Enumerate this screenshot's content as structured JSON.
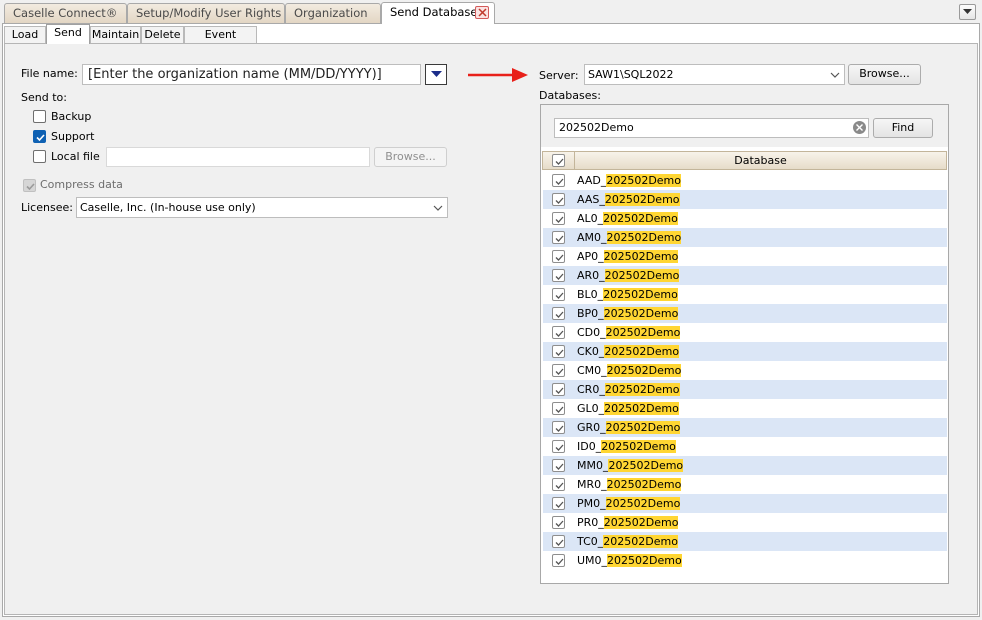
{
  "doc_tabs": [
    {
      "label": "Caselle Connect®",
      "active": false
    },
    {
      "label": "Setup/Modify User Rights",
      "active": false
    },
    {
      "label": "Organization",
      "active": false
    },
    {
      "label": "Send Databases",
      "active": true
    }
  ],
  "sub_tabs": [
    {
      "label": "Load",
      "active": false
    },
    {
      "label": "Send",
      "active": true
    },
    {
      "label": "Maintain",
      "active": false
    },
    {
      "label": "Delete",
      "active": false
    },
    {
      "label": "Event Viewer",
      "active": false
    }
  ],
  "form": {
    "file_name_label": "File name:",
    "file_name_value": "[Enter the organization name (MM/DD/YYYY)]",
    "send_to_label": "Send to:",
    "backup_label": "Backup",
    "backup_checked": false,
    "support_label": "Support",
    "support_checked": true,
    "local_file_label": "Local file",
    "local_file_checked": false,
    "local_file_value": "",
    "browse_local_label": "Browse...",
    "compress_label": "Compress data",
    "compress_checked": true,
    "licensee_label": "Licensee:",
    "licensee_value": "Caselle, Inc. (In-house use only)"
  },
  "server": {
    "label": "Server:",
    "value": "SAW1\\SQL2022",
    "browse_label": "Browse...",
    "annotation_arrow_color": "#e8201a"
  },
  "databases": {
    "label": "Databases:",
    "search_value": "202502Demo",
    "find_label": "Find",
    "column_header": "Database",
    "highlight_color": "#ffd633",
    "rows": [
      {
        "prefix": "AAD_",
        "match": "202502Demo",
        "checked": true
      },
      {
        "prefix": "AAS_",
        "match": "202502Demo",
        "checked": true
      },
      {
        "prefix": "AL0_",
        "match": "202502Demo",
        "checked": true
      },
      {
        "prefix": "AM0_",
        "match": "202502Demo",
        "checked": true
      },
      {
        "prefix": "AP0_",
        "match": "202502Demo",
        "checked": true
      },
      {
        "prefix": "AR0_",
        "match": "202502Demo",
        "checked": true
      },
      {
        "prefix": "BL0_",
        "match": "202502Demo",
        "checked": true
      },
      {
        "prefix": "BP0_",
        "match": "202502Demo",
        "checked": true
      },
      {
        "prefix": "CD0_",
        "match": "202502Demo",
        "checked": true
      },
      {
        "prefix": "CK0_",
        "match": "202502Demo",
        "checked": true
      },
      {
        "prefix": "CM0_",
        "match": "202502Demo",
        "checked": true
      },
      {
        "prefix": "CR0_",
        "match": "202502Demo",
        "checked": true
      },
      {
        "prefix": "GL0_",
        "match": "202502Demo",
        "checked": true
      },
      {
        "prefix": "GR0_",
        "match": "202502Demo",
        "checked": true
      },
      {
        "prefix": "ID0_",
        "match": "202502Demo",
        "checked": true
      },
      {
        "prefix": "MM0_",
        "match": "202502Demo",
        "checked": true
      },
      {
        "prefix": "MR0_",
        "match": "202502Demo",
        "checked": true
      },
      {
        "prefix": "PM0_",
        "match": "202502Demo",
        "checked": true
      },
      {
        "prefix": "PR0_",
        "match": "202502Demo",
        "checked": true
      },
      {
        "prefix": "TC0_",
        "match": "202502Demo",
        "checked": true
      },
      {
        "prefix": "UM0_",
        "match": "202502Demo",
        "checked": true
      }
    ]
  }
}
